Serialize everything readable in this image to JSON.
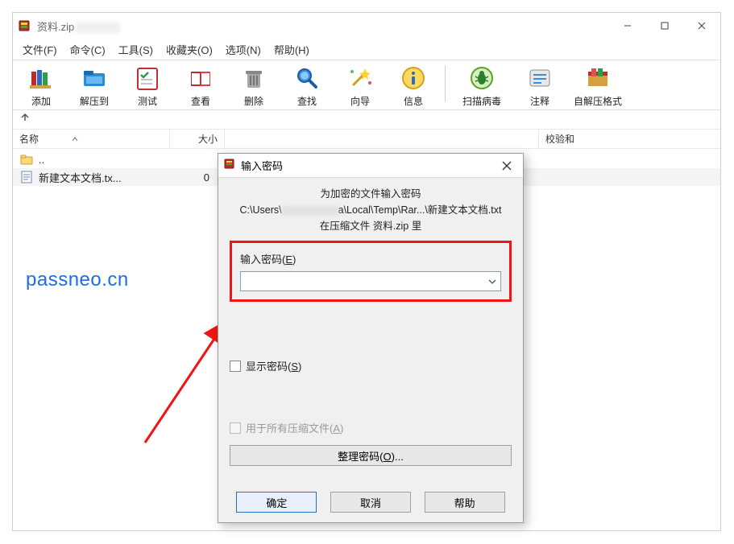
{
  "window": {
    "title": "资料.zip",
    "controls": {
      "minimize": "–",
      "maximize": "▢",
      "close": "✕"
    }
  },
  "menu": {
    "file": "文件(F)",
    "command": "命令(C)",
    "tools": "工具(S)",
    "favorites": "收藏夹(O)",
    "options": "选项(N)",
    "help": "帮助(H)"
  },
  "toolbar": {
    "add": "添加",
    "extract_to": "解压到",
    "test": "测试",
    "view": "查看",
    "delete": "删除",
    "find": "查找",
    "wizard": "向导",
    "info": "信息",
    "virus_scan": "扫描病毒",
    "comment": "注释",
    "sfx": "自解压格式"
  },
  "columns": {
    "name": "名称",
    "size": "大小",
    "cksum": "校验和"
  },
  "rows": {
    "up": "..",
    "file1_name": "新建文本文档.tx...",
    "file1_size": "0"
  },
  "watermark": "passneo.cn",
  "dialog": {
    "title": "输入密码",
    "line1": "为加密的文件输入密码",
    "line2a": "C:\\Users\\",
    "line2b": "a\\Local\\Temp\\Rar...\\新建文本文档.txt",
    "line3": "在压缩文件 资料.zip 里",
    "field_label": "输入密码(E)",
    "pwd_value": "",
    "show_pwd": "显示密码(S)",
    "use_all": "用于所有压缩文件(A)",
    "organize": "整理密码(O)...",
    "ok": "确定",
    "cancel": "取消",
    "help": "帮助"
  }
}
